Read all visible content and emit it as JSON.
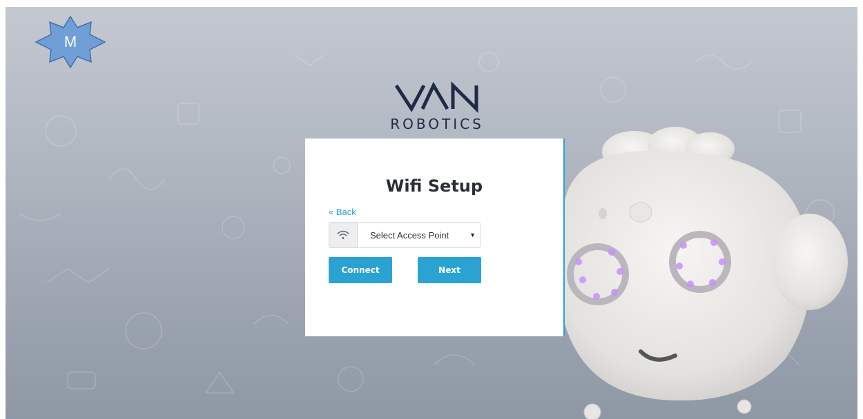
{
  "badge": {
    "label": "M"
  },
  "logo": {
    "word": "ROBOTICS"
  },
  "card": {
    "title": "Wifi Setup",
    "back_label": "« Back",
    "select": {
      "value": "Select Access Point"
    },
    "connect_label": "Connect",
    "next_label": "Next"
  },
  "icons": {
    "wifi": "wifi-icon",
    "chevron": "chevron-down-icon",
    "badge": "star-badge-icon"
  },
  "colors": {
    "accent": "#2aa3d3",
    "badge_fill": "#6f9fd6",
    "logo": "#1f2a44",
    "background": "#b2b8c2"
  }
}
